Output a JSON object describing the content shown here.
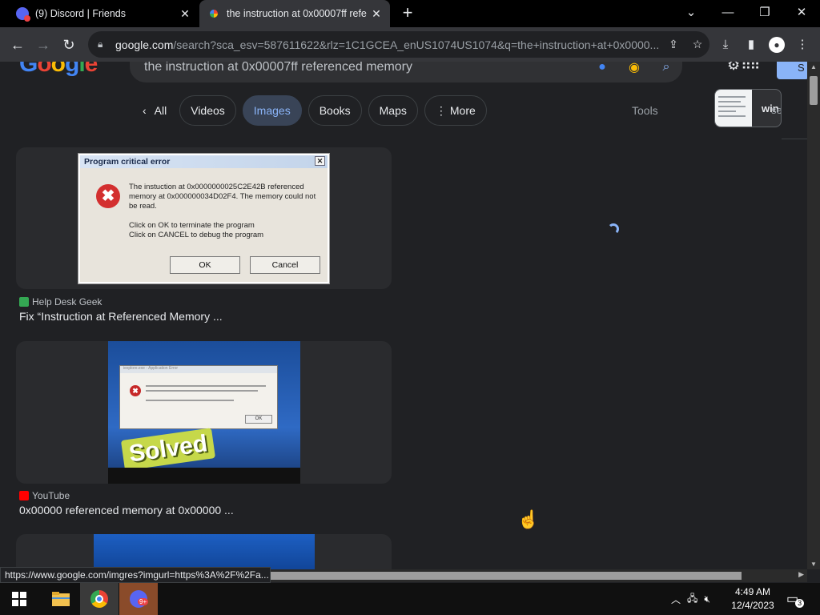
{
  "browser": {
    "tabs": [
      {
        "title": "(9) Discord | Friends",
        "icon": "discord-icon",
        "active": false
      },
      {
        "title": "the instruction at 0x00007ff refe",
        "icon": "google-icon",
        "active": true
      }
    ],
    "new_tab": "+",
    "url_host": "google.com",
    "url_rest": "/search?sca_esv=587611622&rlz=1C1GCEA_enUS1074US1074&q=the+instruction+at+0x0000...",
    "window_controls": {
      "minimize": "—",
      "maximize": "❐",
      "close": "✕",
      "tab_list": "⌄"
    }
  },
  "search": {
    "logo": "Google",
    "query": "the instruction at 0x00007ff referenced memory",
    "signin_label": "S",
    "chips": [
      {
        "label": "All",
        "prefix": "‹",
        "active": false
      },
      {
        "label": "Videos",
        "active": false
      },
      {
        "label": "Images",
        "active": true
      },
      {
        "label": "Books",
        "active": false
      },
      {
        "label": "Maps",
        "active": false
      },
      {
        "label": "More",
        "prefix": "⋮",
        "active": false
      }
    ],
    "tools_label": "Tools",
    "related_label": "win",
    "related_label2": "search"
  },
  "results": [
    {
      "source": "Help Desk Geek",
      "title": "Fix “Instruction at Referenced Memory ...",
      "fav_color": "#34a853",
      "image": {
        "caption": "Program critical error",
        "close": "✕",
        "message1": "The instuction at 0x0000000025C2E42B referenced memory at 0x000000034D02F4. The memory could not be read.",
        "message2": "Click on OK to terminate the program",
        "message3": "Click on CANCEL to debug the program",
        "ok": "OK",
        "cancel": "Cancel"
      }
    },
    {
      "source": "YouTube",
      "title": "0x00000 referenced memory at 0x00000 ...",
      "fav_color": "#ff0000",
      "image": {
        "bar": "iexplore.exe - Application Error",
        "ok": "OK",
        "badge": "Solved"
      }
    }
  ],
  "status_url": "https://www.google.com/imgres?imgurl=https%3A%2F%2Fa...",
  "taskbar": {
    "time": "4:49 AM",
    "date": "12/4/2023",
    "notif_count": "3",
    "discord_badge": "9+"
  }
}
